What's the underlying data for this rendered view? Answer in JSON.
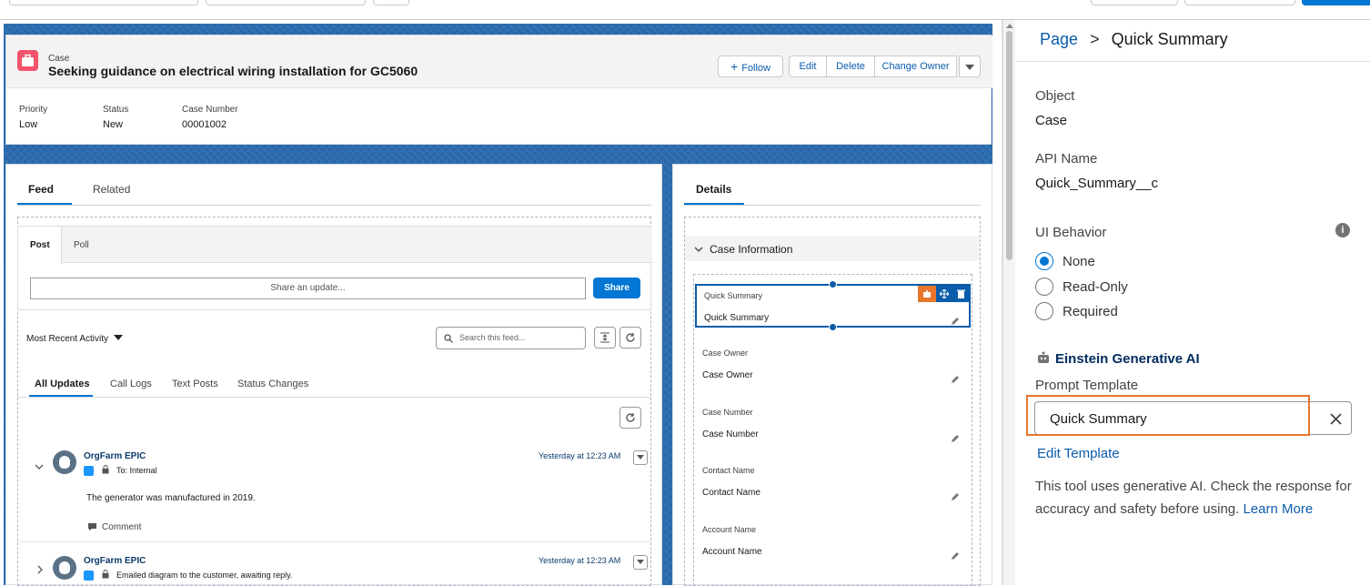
{
  "case_header": {
    "object_label": "Case",
    "title": "Seeking guidance on electrical wiring installation for GC5060",
    "buttons": {
      "follow": "Follow",
      "edit": "Edit",
      "delete": "Delete",
      "change_owner": "Change Owner"
    },
    "fields": [
      {
        "label": "Priority",
        "value": "Low"
      },
      {
        "label": "Status",
        "value": "New"
      },
      {
        "label": "Case Number",
        "value": "00001002"
      }
    ]
  },
  "feed": {
    "tabs": [
      "Feed",
      "Related"
    ],
    "publisher_tabs": [
      "Post",
      "Poll"
    ],
    "share_placeholder": "Share an update...",
    "share_button": "Share",
    "sort_label": "Most Recent Activity",
    "search_placeholder": "Search this feed...",
    "filter_tabs": [
      "All Updates",
      "Call Logs",
      "Text Posts",
      "Status Changes"
    ],
    "items": [
      {
        "author": "OrgFarm EPIC",
        "to": "To: Internal",
        "time": "Yesterday at 12:23 AM",
        "body": "The generator was manufactured in 2019.",
        "action": "Comment"
      },
      {
        "author": "OrgFarm EPIC",
        "to": "Emailed diagram to the customer, awaiting reply.",
        "time": "Yesterday at 12:23 AM"
      }
    ]
  },
  "details": {
    "tab": "Details",
    "section": "Case Information",
    "fields": [
      {
        "label": "Quick Summary",
        "value": "Quick Summary"
      },
      {
        "label": "Case Owner",
        "value": "Case Owner"
      },
      {
        "label": "Case Number",
        "value": "Case Number"
      },
      {
        "label": "Contact Name",
        "value": "Contact Name"
      },
      {
        "label": "Account Name",
        "value": "Account Name"
      }
    ]
  },
  "right_panel": {
    "breadcrumb_page": "Page",
    "breadcrumb_sep": ">",
    "breadcrumb_current": "Quick Summary",
    "object_label": "Object",
    "object_value": "Case",
    "api_label": "API Name",
    "api_value": "Quick_Summary__c",
    "ui_behavior_label": "UI Behavior",
    "ui_options": [
      "None",
      "Read-Only",
      "Required"
    ],
    "ui_selected": "None",
    "einstein_title": "Einstein Generative AI",
    "prompt_label": "Prompt Template",
    "prompt_value": "Quick Summary",
    "edit_template": "Edit Template",
    "disclaimer": "This tool uses generative AI. Check the response for accuracy and safety before using.",
    "learn_more": "Learn More"
  },
  "colors": {
    "accent": "#0176d3",
    "highlight": "#e8762d",
    "case_icon": "#f2536d",
    "canvas": "#2b6cb0"
  }
}
